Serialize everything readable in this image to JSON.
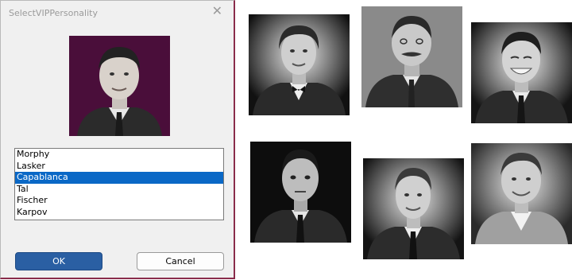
{
  "dialog": {
    "title": "SelectVIPPersonality",
    "close_glyph": "✕",
    "items": [
      "Morphy",
      "Lasker",
      "Capablanca",
      "Tal",
      "Fischer",
      "Karpov"
    ],
    "selected": "Capablanca",
    "ok_label": "OK",
    "cancel_label": "Cancel"
  },
  "colors": {
    "selection": "#0a68c6",
    "ok_button": "#2a5fa3",
    "preview_background": "#4a0e3a"
  },
  "portraits": [
    {
      "name": "morphy-portrait"
    },
    {
      "name": "lasker-portrait"
    },
    {
      "name": "capablanca-portrait"
    },
    {
      "name": "tal-portrait"
    },
    {
      "name": "fischer-portrait"
    },
    {
      "name": "karpov-portrait"
    }
  ]
}
